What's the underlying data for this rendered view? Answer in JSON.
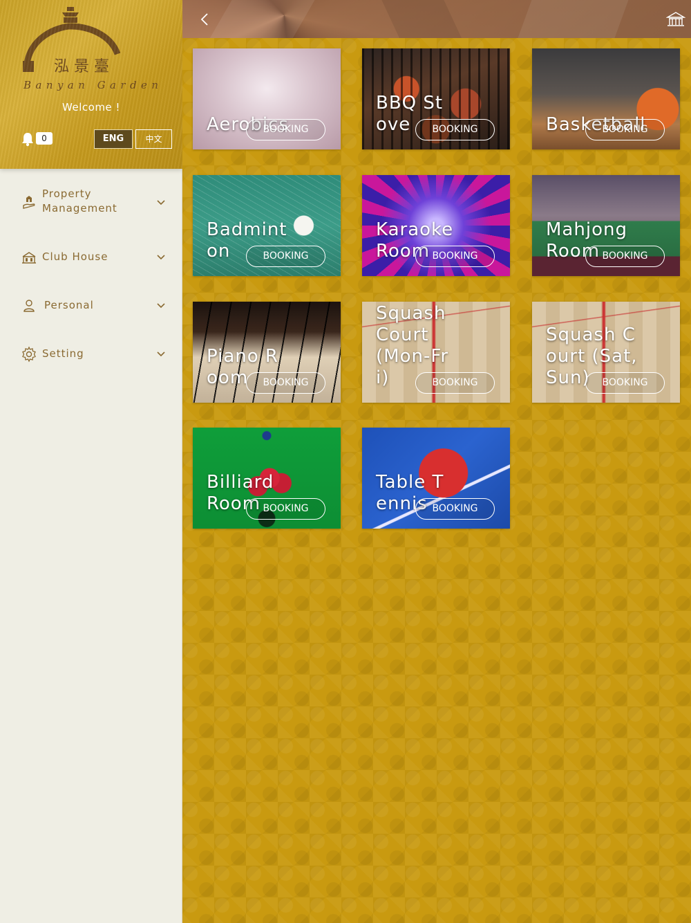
{
  "app": {
    "logo_cn": "泓 景 臺",
    "logo_en": "Banyan Garden",
    "welcome": "Welcome !",
    "notification_count": "0",
    "lang_eng": "ENG",
    "lang_zh": "中文"
  },
  "menu": {
    "property_management": "Property\nManagement",
    "club_house": "Club House",
    "personal": "Personal",
    "setting": "Setting"
  },
  "facilities": [
    {
      "name": "Aerobics",
      "booking": "BOOKING"
    },
    {
      "name": "BBQ Stove",
      "booking": "BOOKING"
    },
    {
      "name": "Basketball",
      "booking": "BOOKING"
    },
    {
      "name": "Badminton",
      "booking": "BOOKING"
    },
    {
      "name": "Karaoke Room",
      "booking": "BOOKING"
    },
    {
      "name": "Mahjong Room",
      "booking": "BOOKING"
    },
    {
      "name": "Piano Room",
      "booking": "BOOKING"
    },
    {
      "name": "Squash Court (Mon-Fri)",
      "booking": "BOOKING"
    },
    {
      "name": "Squash Court (Sat,Sun)",
      "booking": "BOOKING"
    },
    {
      "name": "Billiard Room",
      "booking": "BOOKING"
    },
    {
      "name": "Table Tennis",
      "booking": "BOOKING"
    }
  ],
  "icons": {
    "back": "chevron-left-icon",
    "home": "clubhouse-home-icon",
    "bell": "bell-icon"
  },
  "colors": {
    "gold_background": "#c99a10",
    "menu_text": "#8a6a32",
    "sidebar_bg": "#efeee4"
  }
}
